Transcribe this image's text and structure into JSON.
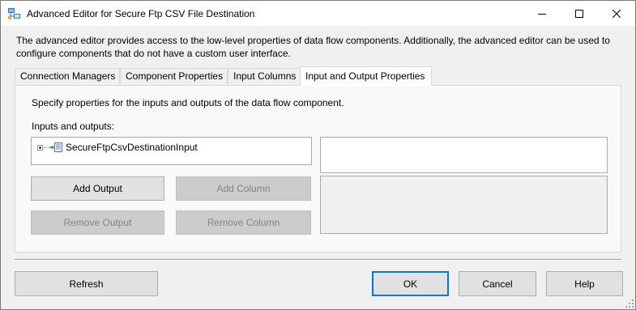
{
  "window": {
    "title": "Advanced Editor for Secure Ftp CSV File Destination",
    "app_icon": "ssis-component-icon",
    "controls": [
      "minimize-icon",
      "maximize-icon",
      "close-icon"
    ]
  },
  "description": "The advanced editor provides access to the low-level properties of data flow components. Additionally, the advanced editor can be used to configure components that do not have a custom user interface.",
  "tabs": [
    {
      "label": "Connection Managers",
      "active": false
    },
    {
      "label": "Component Properties",
      "active": false
    },
    {
      "label": "Input Columns",
      "active": false
    },
    {
      "label": "Input and Output Properties",
      "active": true
    }
  ],
  "panel": {
    "description": "Specify properties for the inputs and outputs of the data flow component.",
    "io_label": "Inputs and outputs:",
    "tree": [
      {
        "label": "SecureFtpCsvDestinationInput",
        "icon": "input-node-icon",
        "expanded": false
      }
    ],
    "buttons": {
      "add_output": "Add Output",
      "add_column": "Add Column",
      "remove_output": "Remove Output",
      "remove_column": "Remove Column"
    }
  },
  "footer": {
    "refresh": "Refresh",
    "ok": "OK",
    "cancel": "Cancel",
    "help": "Help"
  },
  "colors": {
    "default_button_border": "#0078d7",
    "disabled_text": "#838383"
  }
}
